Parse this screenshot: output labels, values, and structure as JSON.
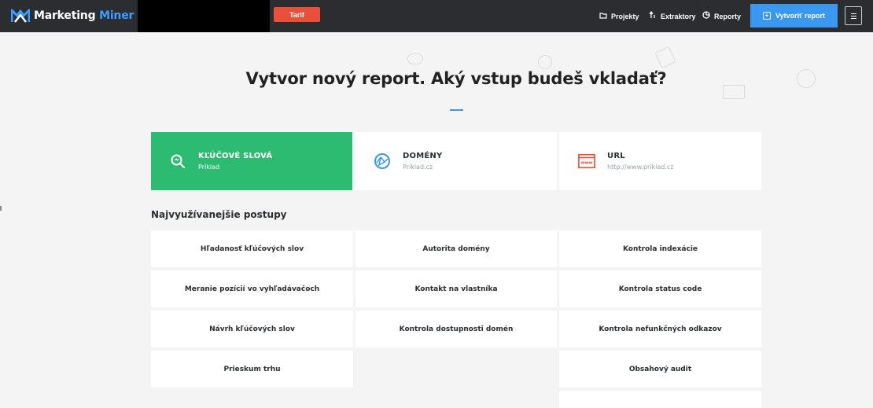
{
  "topbar": {
    "brand": {
      "name_part1": "Marketing",
      "name_part2": "Miner"
    },
    "tarif_label": "Tarif",
    "nav": [
      {
        "label": "Projekty",
        "icon": "folder-icon"
      },
      {
        "label": "Extraktory",
        "icon": "extract-icon"
      },
      {
        "label": "Reporty",
        "icon": "chart-icon"
      }
    ],
    "create_report_label": "Vytvoriť report",
    "colors": {
      "bar": "#2b2d31",
      "tarif": "#e8503a",
      "accent": "#3b98f0"
    }
  },
  "main": {
    "heading": "Vytvor nový report. Aký vstup budeš vkladať?",
    "input_types": [
      {
        "title": "KĽÚČOVÉ SLOVÁ",
        "subtitle": "Príklad",
        "icon": "search-icon",
        "active": true
      },
      {
        "title": "DOMÉNY",
        "subtitle": "Príklad.cz",
        "icon": "globe-icon",
        "active": false
      },
      {
        "title": "URL",
        "subtitle": "http://www.priklad.cz",
        "icon": "browser-window-icon",
        "active": false
      }
    ],
    "procedures_title": "Najvyužívanejšie postupy",
    "procedures": {
      "col1": [
        "Hľadanosť kľúčových slov",
        "Meranie pozícií vo vyhľadávačoch",
        "Návrh kľúčových slov",
        "Prieskum trhu"
      ],
      "col2": [
        "Autorita domény",
        "Kontakt na vlastníka",
        "Kontrola dostupnosti domén"
      ],
      "col3": [
        "Kontrola indexácie",
        "Kontrola status code",
        "Kontrola nefunkčných odkazov",
        "Obsahový audit",
        ""
      ]
    },
    "colors": {
      "active_card": "#2dbb72",
      "background": "#f4f4f4"
    }
  }
}
